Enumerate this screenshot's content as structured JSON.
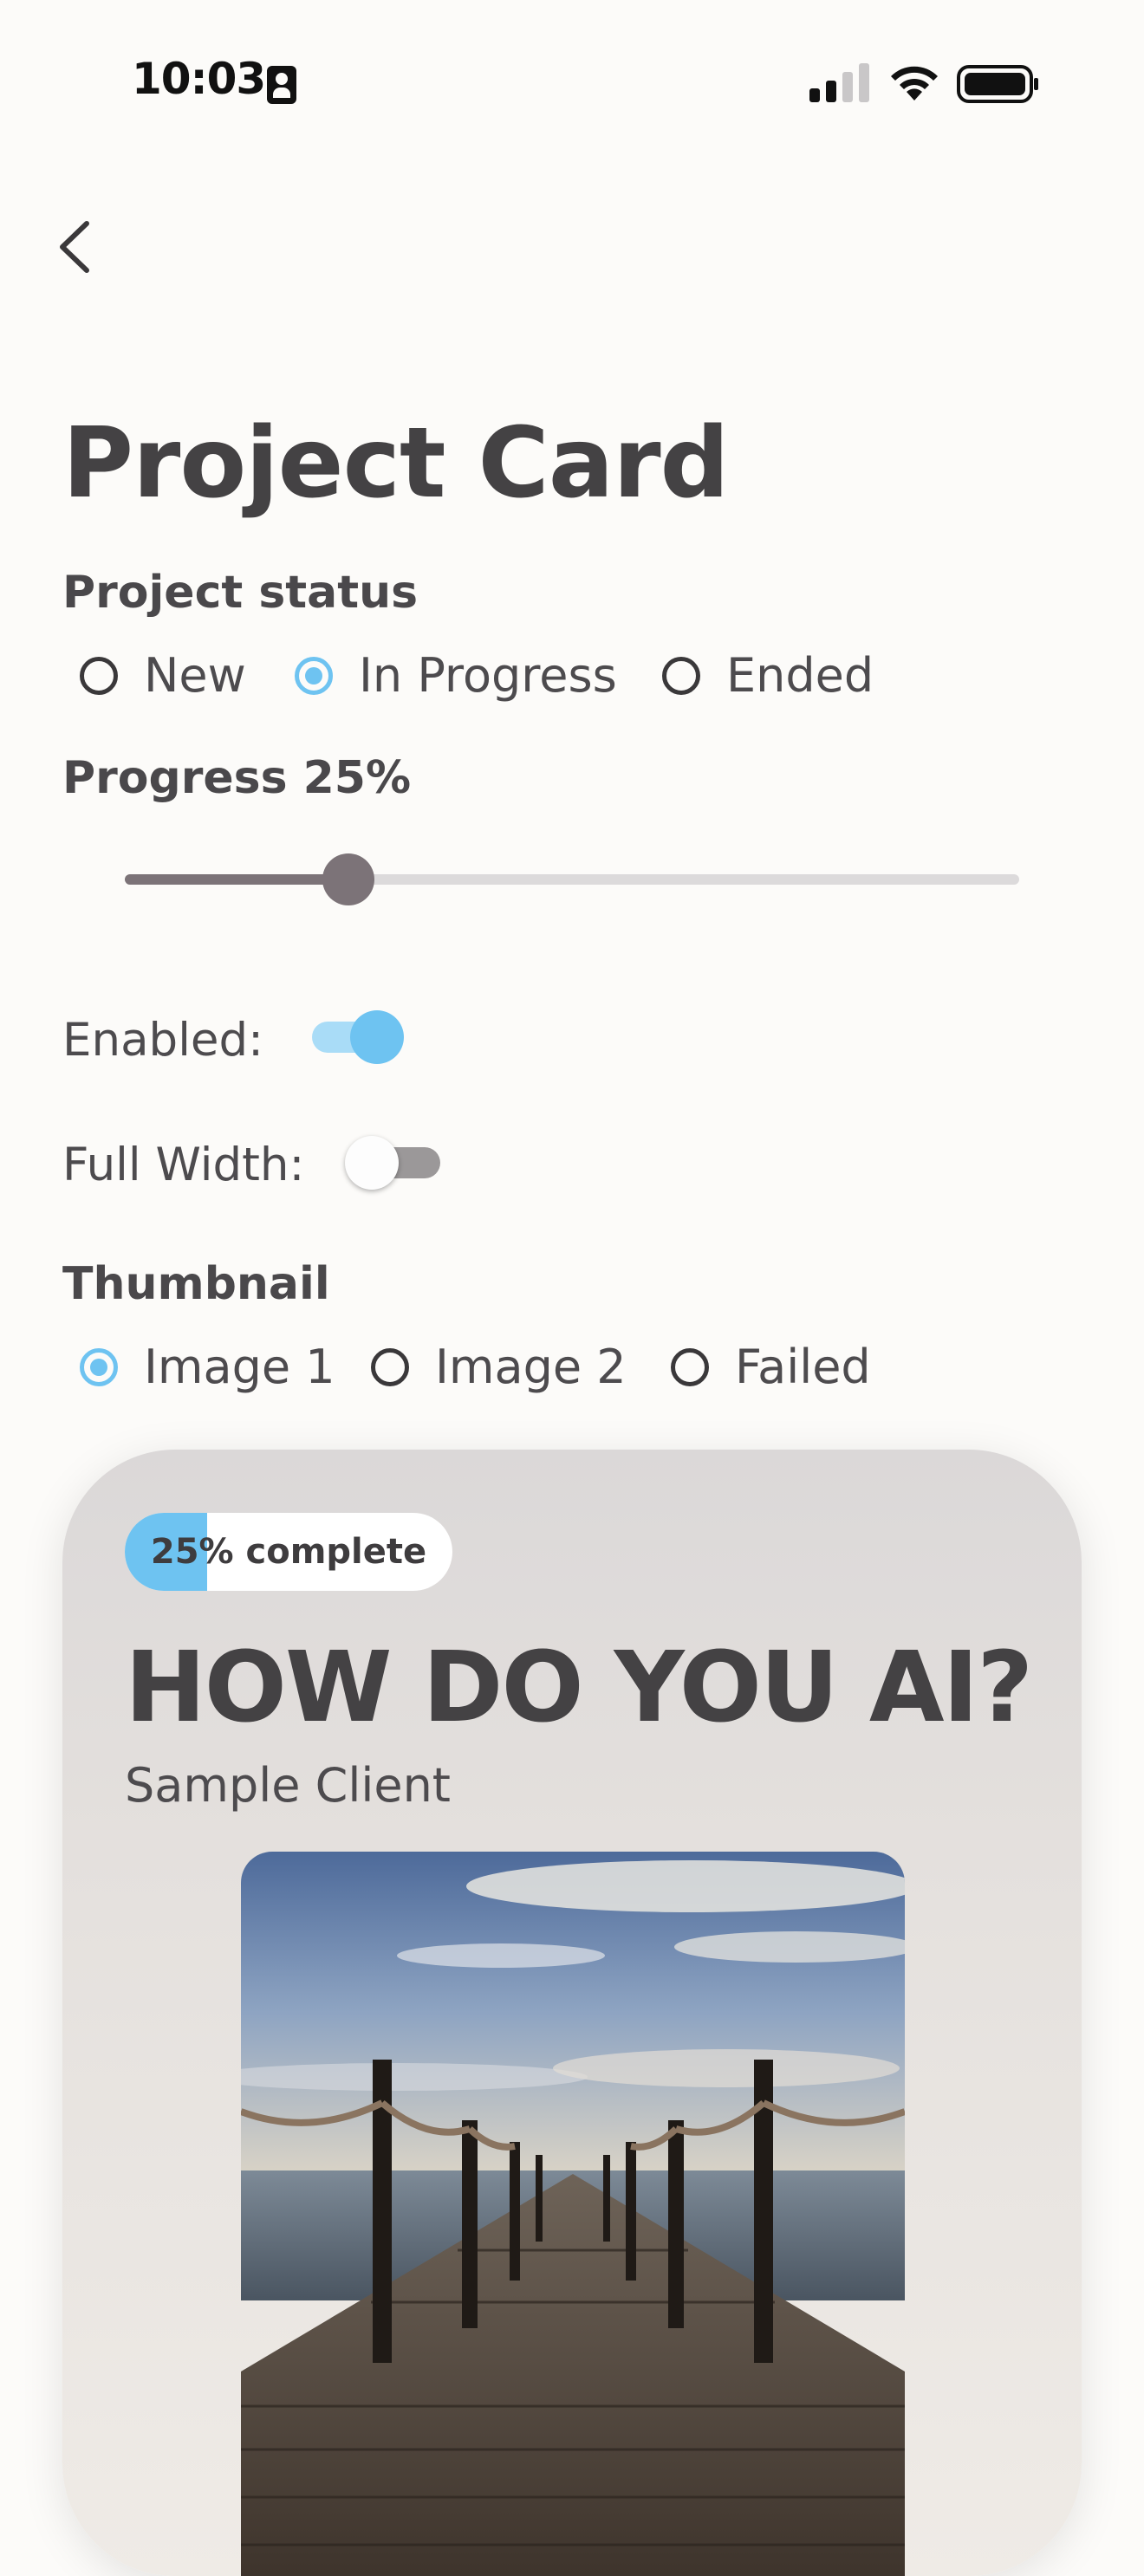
{
  "status_bar": {
    "time": "10:03"
  },
  "page": {
    "title": "Project Card"
  },
  "project_status": {
    "label": "Project status",
    "options": [
      "New",
      "In Progress",
      "Ended"
    ],
    "selected": "In Progress"
  },
  "progress": {
    "label": "Progress 25%",
    "value": 0.25
  },
  "enabled": {
    "label": "Enabled:",
    "on": true
  },
  "full_width": {
    "label": "Full Width:",
    "on": false
  },
  "thumbnail": {
    "label": "Thumbnail",
    "options": [
      "Image 1",
      "Image 2",
      "Failed"
    ],
    "selected": "Image 1"
  },
  "card": {
    "badge": "25% complete",
    "progress": 0.25,
    "title": "HOW DO YOU AI?",
    "client": "Sample Client"
  },
  "colors": {
    "accent": "#6ec3f1",
    "slider": "#7c7378",
    "text": "#454345",
    "background": "#fcfbf9"
  },
  "icons": {
    "back": "chevron-left-icon",
    "signal": "cellular-signal-icon",
    "wifi": "wifi-icon",
    "battery": "battery-icon",
    "badge": "id-badge-icon"
  }
}
